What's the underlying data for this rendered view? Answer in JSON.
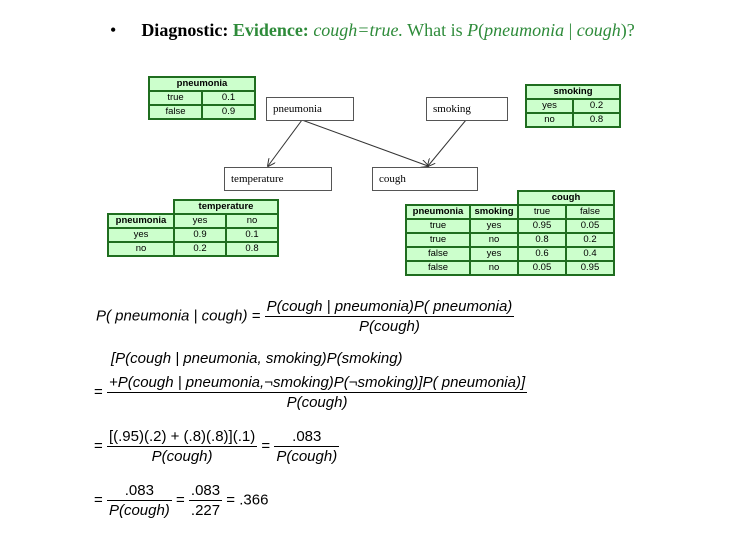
{
  "header": {
    "bullet": "•",
    "diagnostic": "Diagnostic:",
    "evidence_label": "Evidence:",
    "evidence_value": "cough=true.",
    "question_prefix": "What is ",
    "question_p": "P",
    "question_open": "(",
    "question_query": "pneumonia",
    "question_bar": " | ",
    "question_given": "cough",
    "question_close": ")?"
  },
  "nodes": {
    "pneumonia": "pneumonia",
    "smoking": "smoking",
    "temperature": "temperature",
    "cough": "cough"
  },
  "cpt_pneumonia": {
    "title": "pneumonia",
    "rows": [
      [
        "true",
        "0.1"
      ],
      [
        "false",
        "0.9"
      ]
    ]
  },
  "cpt_smoking": {
    "title": "smoking",
    "rows": [
      [
        "yes",
        "0.2"
      ],
      [
        "no",
        "0.8"
      ]
    ]
  },
  "cpt_temperature": {
    "title": "temperature",
    "parent": "pneumonia",
    "cols": [
      "yes",
      "no"
    ],
    "rows": [
      [
        "yes",
        "0.9",
        "0.1"
      ],
      [
        "no",
        "0.2",
        "0.8"
      ]
    ]
  },
  "cpt_cough": {
    "title": "cough",
    "parents": [
      "pneumonia",
      "smoking"
    ],
    "cols": [
      "true",
      "false"
    ],
    "rows": [
      [
        "true",
        "yes",
        "0.95",
        "0.05"
      ],
      [
        "true",
        "no",
        "0.8",
        "0.2"
      ],
      [
        "false",
        "yes",
        "0.6",
        "0.4"
      ],
      [
        "false",
        "no",
        "0.05",
        "0.95"
      ]
    ]
  },
  "equations": {
    "eq1_lhs": "P( pneumonia | cough) =",
    "eq1_num": "P(cough | pneumonia)P( pneumonia)",
    "eq1_den": "P(cough)",
    "eq2_line1": "[P(cough | pneumonia, smoking)P(smoking)",
    "eq2_eq": "=",
    "eq2_num": "+P(cough | pneumonia,¬smoking)P(¬smoking)]P( pneumonia)]",
    "eq2_den": "P(cough)",
    "eq3_eq": "=",
    "eq3_num": "[(.95)(.2) + (.8)(.8)](.1)",
    "eq3_den": "P(cough)",
    "eq3_eq2": "=",
    "eq3_num2": ".083",
    "eq3_den2": "P(cough)",
    "eq4_eq": "=",
    "eq4_num": ".083",
    "eq4_den": "P(cough)",
    "eq4_eq2": "=",
    "eq4_num2": ".083",
    "eq4_den2": ".227",
    "eq4_result": "= .366"
  }
}
